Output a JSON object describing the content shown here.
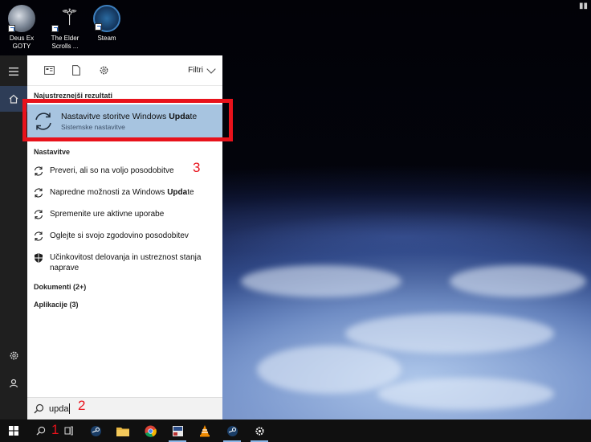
{
  "desktop": {
    "icons": [
      {
        "label": "Deus Ex GOTY",
        "icon": "deus-ex-icon"
      },
      {
        "label": "The Elder Scrolls ...",
        "icon": "elder-scrolls-icon"
      },
      {
        "label": "Steam",
        "icon": "steam-icon"
      }
    ]
  },
  "search_panel": {
    "filter_label": "Filtri",
    "best_match_header": "Najustreznejši rezultati",
    "best_match": {
      "title_prefix": "Nastavitve storitve Windows ",
      "title_bold": "Upda",
      "title_suffix": "te",
      "subtitle": "Sistemske nastavitve"
    },
    "settings_header": "Nastavitve",
    "settings_items": [
      {
        "label": "Preveri, ali so na voljo posodobitve",
        "icon": "refresh-icon"
      },
      {
        "label_prefix": "Napredne možnosti za Windows ",
        "label_bold": "Upda",
        "label_suffix": "te",
        "icon": "refresh-icon"
      },
      {
        "label": "Spremenite ure aktivne uporabe",
        "icon": "refresh-icon"
      },
      {
        "label": "Oglejte si svojo zgodovino posodobitev",
        "icon": "refresh-icon"
      },
      {
        "label": "Učinkovitost delovanja in ustreznost stanja naprave",
        "icon": "shield-icon"
      }
    ],
    "categories": [
      {
        "label": "Dokumenti (2+)"
      },
      {
        "label": "Aplikacije (3)"
      }
    ],
    "query": "upda"
  },
  "annotations": {
    "num1": "1",
    "num2": "2",
    "num3": "3",
    "color": "#e8121b"
  },
  "taskbar": {
    "items": [
      "windows-start-icon",
      "search-icon",
      "task-view-icon",
      "steam-icon",
      "file-explorer-icon",
      "chrome-icon",
      "app-icon",
      "vlc-icon",
      "steam-icon",
      "settings-gear-icon"
    ]
  }
}
